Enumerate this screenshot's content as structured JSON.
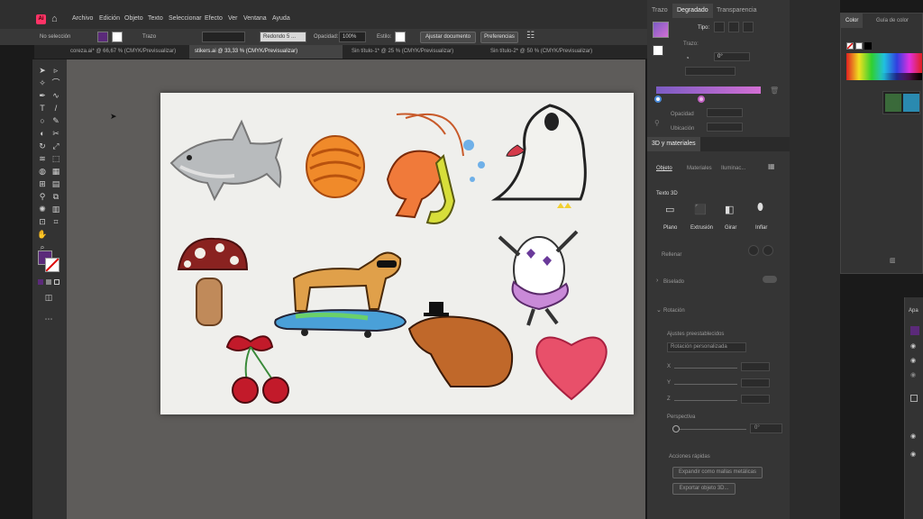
{
  "menu": {
    "logo": "Ai",
    "items": [
      "Archivo",
      "Edición",
      "Objeto",
      "Texto",
      "Seleccionar",
      "Efecto",
      "Ver",
      "Ventana",
      "Ayuda"
    ]
  },
  "control_bar": {
    "selection": "No selección",
    "stroke_label": "Trazo",
    "brush_label": "Redondo 5 ...",
    "opacity_label": "Opacidad:",
    "opacity_value": "100%",
    "style_label": "Estilo:",
    "align_doc_button": "Ajustar documento",
    "preferences_button": "Preferencias"
  },
  "tabs": [
    {
      "label": "coreza.ai* @ 66,67 % (CMYK/Previsualizar)"
    },
    {
      "label": "stikers.ai @ 33,33 % (CMYK/Previsualizar)"
    },
    {
      "label": "Sin título-1* @ 25 % (CMYK/Previsualizar)"
    },
    {
      "label": "Sin título-2* @ 50 % (CMYK/Previsualizar)"
    }
  ],
  "colors": {
    "fill": "#5b2a7a",
    "gradient_start": "#7b5cc4",
    "gradient_end": "#d36fd4",
    "canvas": "#5e5c5a"
  },
  "panel_gradient": {
    "tabs": [
      "Trazo",
      "Degradado",
      "Transparencia"
    ],
    "type_label": "Tipo:",
    "stroke_label": "Trazo:",
    "angle_value": "0°",
    "opacity_label": "Opacidad",
    "location_label": "Ubicación"
  },
  "panel_3d": {
    "title": "3D y materiales",
    "subtabs": [
      "Objeto",
      "Materiales",
      "Iluminac..."
    ],
    "section_3d_text": "Texto 3D",
    "types": [
      "Plano",
      "Extrusión",
      "Girar",
      "Inflar"
    ],
    "fill_label": "Rellenar",
    "bevel_label": "Biselado",
    "rotation_label": "Rotación",
    "presets_label": "Ajustes preestablecidos",
    "preset_value": "Rotación personalizada",
    "axes": [
      "X",
      "Y",
      "Z"
    ],
    "perspective_label": "Perspectiva",
    "perspective_value": "0°",
    "quick_actions_label": "Acciones rápidas",
    "expand_button": "Expandir como mallas metálicas",
    "export_button": "Exportar objeto 3D..."
  },
  "panel_color": {
    "tabs": [
      "Color",
      "Guía de color"
    ]
  },
  "panel_appearance": {
    "tab": "Apa"
  },
  "stickers": [
    {
      "name": "shark"
    },
    {
      "name": "concha-bread"
    },
    {
      "name": "shrimp-saxophone"
    },
    {
      "name": "ghost-opera"
    },
    {
      "name": "mushroom"
    },
    {
      "name": "dachshund-skateboard"
    },
    {
      "name": "dancing-cow"
    },
    {
      "name": "cherries-bow"
    },
    {
      "name": "capybara-tophat"
    },
    {
      "name": "heart"
    }
  ]
}
